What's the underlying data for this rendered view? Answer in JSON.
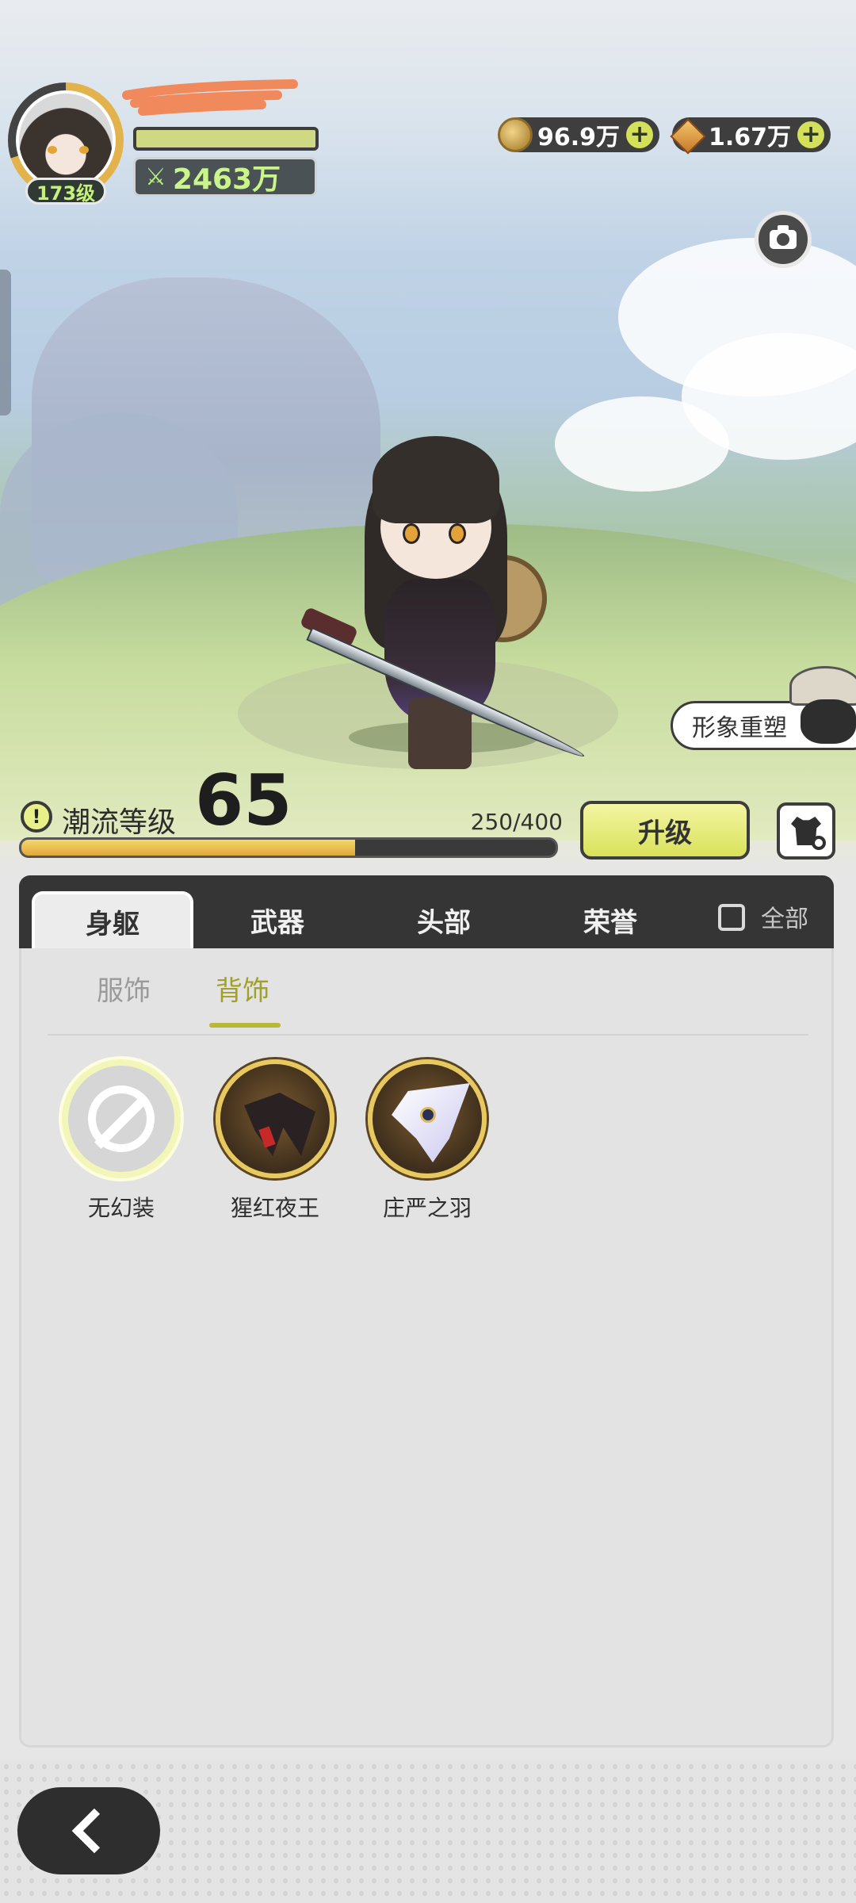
{
  "player": {
    "level": "173级",
    "power_value": "2463万",
    "power_icon": "fist-power-icon"
  },
  "currencies": [
    {
      "icon": "gold-coin-icon",
      "value": "96.9万"
    },
    {
      "icon": "star-gem-icon",
      "value": "1.67万"
    }
  ],
  "scene": {
    "reshape_label": "形象重塑"
  },
  "trend": {
    "label": "潮流等级",
    "level": "65",
    "xp_text": "250/400",
    "xp_current": 250,
    "xp_max": 400,
    "upgrade_label": "升级"
  },
  "tabs": [
    {
      "label": "身躯",
      "active": true
    },
    {
      "label": "武器",
      "active": false
    },
    {
      "label": "头部",
      "active": false
    },
    {
      "label": "荣誉",
      "active": false
    }
  ],
  "all_toggle": {
    "label": "全部",
    "checked": false
  },
  "subtabs": [
    {
      "label": "服饰",
      "active": false
    },
    {
      "label": "背饰",
      "active": true
    }
  ],
  "items": [
    {
      "label": "无幻装",
      "icon": "no-illusion-icon"
    },
    {
      "label": "猩红夜王",
      "icon": "crimson-night-king-icon"
    },
    {
      "label": "庄严之羽",
      "icon": "solemn-feather-icon"
    }
  ],
  "colors": {
    "accent": "#d9e25a",
    "active_subtab": "#a1a02a",
    "tab_bar": "#353535"
  }
}
